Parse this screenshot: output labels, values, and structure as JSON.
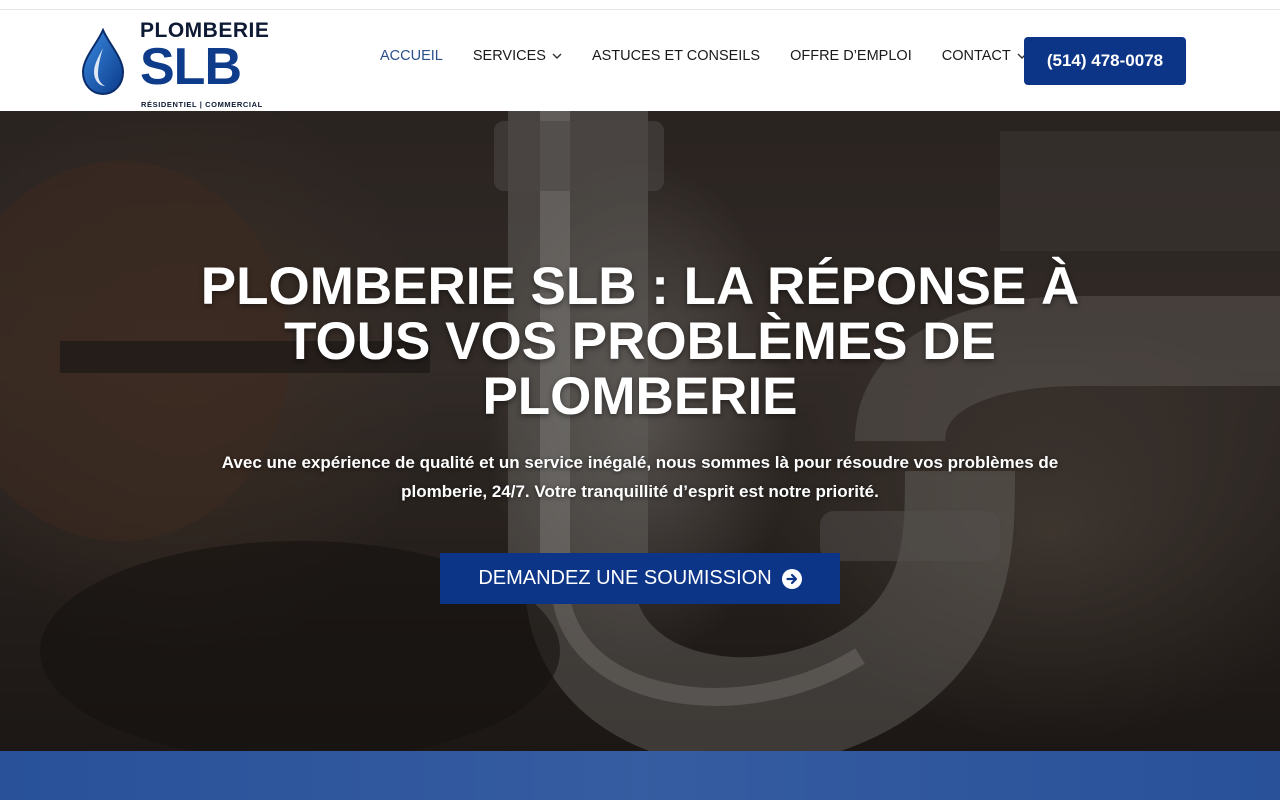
{
  "header": {
    "logo": {
      "brand_top": "PLOMBERIE",
      "brand_main": "SLB",
      "brand_sub": "RÉSIDENTIEL | COMMERCIAL"
    },
    "nav": [
      {
        "label": "ACCUEIL",
        "active": true,
        "has_dropdown": false
      },
      {
        "label": "SERVICES",
        "active": false,
        "has_dropdown": true
      },
      {
        "label": "ASTUCES ET CONSEILS",
        "active": false,
        "has_dropdown": false
      },
      {
        "label": "OFFRE D’EMPLOI",
        "active": false,
        "has_dropdown": false
      },
      {
        "label": "CONTACT",
        "active": false,
        "has_dropdown": true
      }
    ],
    "phone_label": "(514) 478-0078"
  },
  "hero": {
    "title": "PLOMBERIE SLB : LA RÉPONSE À TOUS VOS PROBLÈMES DE PLOMBERIE",
    "subtitle": "Avec une expérience de qualité et un service inégalé, nous sommes là pour résoudre vos problèmes de plomberie, 24/7. Votre tranquillité d’esprit est notre priorité.",
    "cta_label": "DEMANDEZ UNE SOUMISSION"
  },
  "icons": {
    "logo": "water-drop-icon",
    "dropdown": "chevron-down-icon",
    "cta": "arrow-right-circle-icon"
  },
  "colors": {
    "brand_blue": "#0d3587",
    "nav_active": "#2a4f8a",
    "bottom_band": "#1f4a96"
  }
}
